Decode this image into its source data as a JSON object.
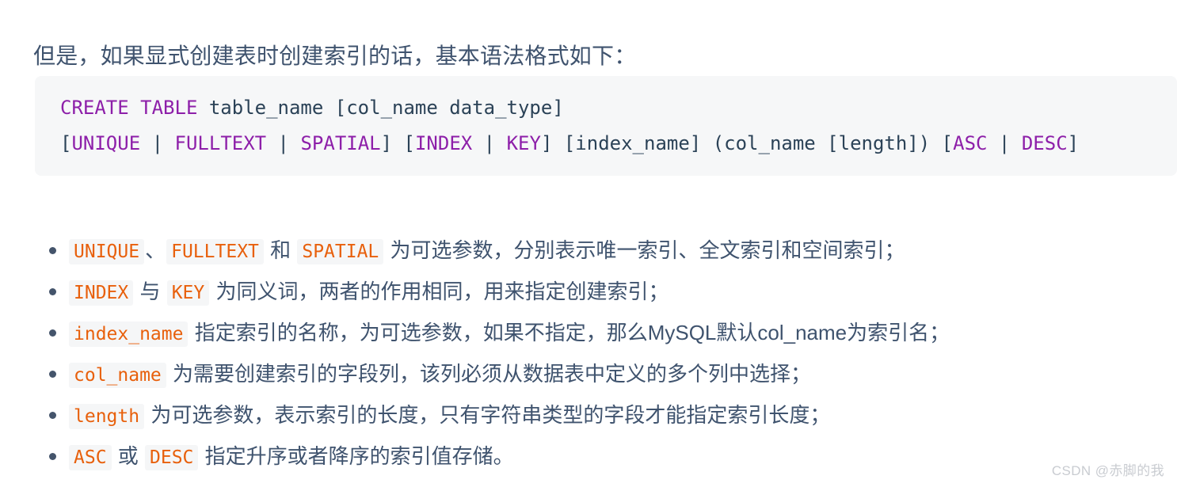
{
  "page": {
    "background": "#ffffff",
    "text_color": "#3f536e"
  },
  "intro": {
    "text": "但是，如果显式创建表时创建索引的话，基本语法格式如下："
  },
  "code_block": {
    "background": "#f6f7f8",
    "keyword_color": "#8d1fa9",
    "plain_color": "#2b4257",
    "lines": [
      {
        "id": "code-line-1",
        "tokens": [
          {
            "text": "CREATE TABLE",
            "type": "keyword"
          },
          {
            "text": " table_name [col_name data_type]",
            "type": "plain"
          }
        ]
      },
      {
        "id": "code-line-2",
        "tokens": [
          {
            "text": "[",
            "type": "plain"
          },
          {
            "text": "UNIQUE",
            "type": "keyword"
          },
          {
            "text": " | ",
            "type": "plain"
          },
          {
            "text": "FULLTEXT",
            "type": "keyword"
          },
          {
            "text": " | ",
            "type": "plain"
          },
          {
            "text": "SPATIAL",
            "type": "keyword"
          },
          {
            "text": "] [",
            "type": "plain"
          },
          {
            "text": "INDEX",
            "type": "keyword"
          },
          {
            "text": " | ",
            "type": "plain"
          },
          {
            "text": "KEY",
            "type": "keyword"
          },
          {
            "text": "] [index_name] (col_name [length]) [",
            "type": "plain"
          },
          {
            "text": "ASC",
            "type": "keyword"
          },
          {
            "text": " | ",
            "type": "plain"
          },
          {
            "text": "DESC",
            "type": "keyword"
          },
          {
            "text": "]",
            "type": "plain"
          }
        ]
      }
    ],
    "plain_text": "CREATE TABLE table_name [col_name data_type]\n[UNIQUE | FULLTEXT | SPATIAL] [INDEX | KEY] [index_name] (col_name [length]) [ASC | DESC]"
  },
  "bullets": {
    "marker_color": "#44546b",
    "inline_code_color": "#e8600c",
    "inline_code_background": "#f5f6f7",
    "items": [
      {
        "id": "bullet-1",
        "parts": [
          {
            "text": "UNIQUE",
            "type": "code"
          },
          {
            "text": "、",
            "type": "text"
          },
          {
            "text": "FULLTEXT",
            "type": "code"
          },
          {
            "text": " 和 ",
            "type": "text"
          },
          {
            "text": "SPATIAL",
            "type": "code"
          },
          {
            "text": " 为可选参数，分别表示唯一索引、全文索引和空间索引；",
            "type": "text"
          }
        ]
      },
      {
        "id": "bullet-2",
        "parts": [
          {
            "text": "INDEX",
            "type": "code"
          },
          {
            "text": " 与 ",
            "type": "text"
          },
          {
            "text": "KEY",
            "type": "code"
          },
          {
            "text": " 为同义词，两者的作用相同，用来指定创建索引；",
            "type": "text"
          }
        ]
      },
      {
        "id": "bullet-3",
        "parts": [
          {
            "text": "index_name",
            "type": "code"
          },
          {
            "text": " 指定索引的名称，为可选参数，如果不指定，那么MySQL默认col_name为索引名；",
            "type": "text"
          }
        ]
      },
      {
        "id": "bullet-4",
        "parts": [
          {
            "text": "col_name",
            "type": "code"
          },
          {
            "text": " 为需要创建索引的字段列，该列必须从数据表中定义的多个列中选择；",
            "type": "text"
          }
        ]
      },
      {
        "id": "bullet-5",
        "parts": [
          {
            "text": "length",
            "type": "code"
          },
          {
            "text": " 为可选参数，表示索引的长度，只有字符串类型的字段才能指定索引长度；",
            "type": "text"
          }
        ]
      },
      {
        "id": "bullet-6",
        "parts": [
          {
            "text": "ASC",
            "type": "code"
          },
          {
            "text": " 或 ",
            "type": "text"
          },
          {
            "text": "DESC",
            "type": "code"
          },
          {
            "text": " 指定升序或者降序的索引值存储。",
            "type": "text"
          }
        ]
      }
    ]
  },
  "watermark": {
    "text": "CSDN @赤脚的我",
    "color": "#c9ccd1"
  }
}
